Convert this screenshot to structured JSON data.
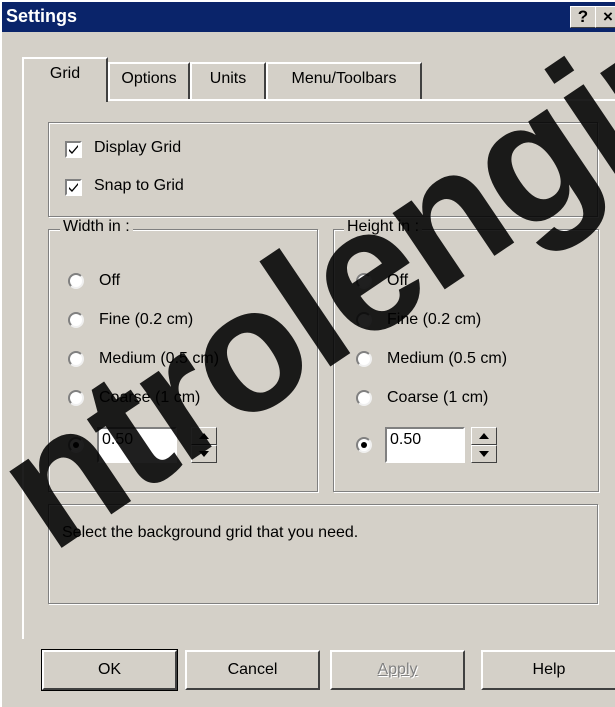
{
  "dialog": {
    "title": "Settings",
    "help_btn": "?",
    "close_btn": "×"
  },
  "tabs": [
    {
      "label": "Grid",
      "active": true
    },
    {
      "label": "Options",
      "active": false
    },
    {
      "label": "Units",
      "active": false
    },
    {
      "label": "Menu/Toolbars",
      "active": false
    }
  ],
  "display": {
    "display_grid": {
      "label": "Display Grid",
      "checked": true
    },
    "snap_to_grid": {
      "label": "Snap to Grid",
      "checked": true
    }
  },
  "width_group": {
    "title": "Width in :",
    "options": [
      "Off",
      "Fine (0.2 cm)",
      "Medium (0.5 cm)",
      "Coarse (1 cm)"
    ],
    "custom_value": "0.50",
    "selected": "custom"
  },
  "height_group": {
    "title": "Height in :",
    "options": [
      "Off",
      "Fine (0.2 cm)",
      "Medium (0.5 cm)",
      "Coarse (1 cm)"
    ],
    "custom_value": "0.50",
    "selected": "custom"
  },
  "description": "Select the background grid that you need.",
  "buttons": {
    "ok": "OK",
    "cancel": "Cancel",
    "apply": "Apply",
    "help": "Help"
  },
  "watermark": "ntrolengin"
}
